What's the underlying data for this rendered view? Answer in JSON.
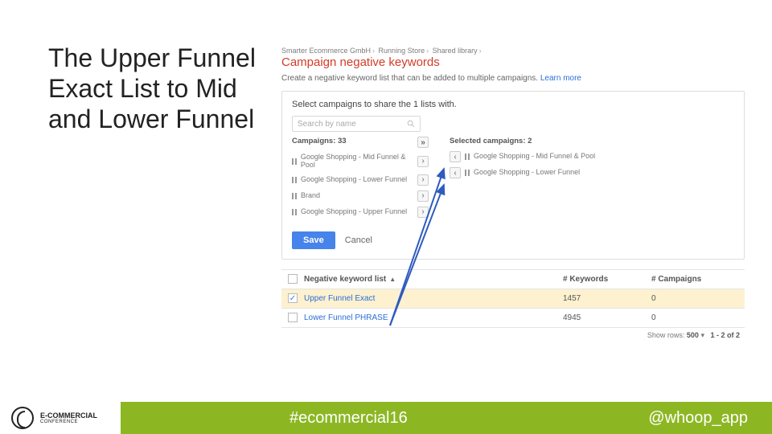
{
  "slide_title": "The Upper Funnel Exact List to Mid and Lower Funnel",
  "breadcrumbs": [
    "Smarter Ecommerce GmbH",
    "Running Store",
    "Shared library"
  ],
  "page_heading": "Campaign negative keywords",
  "description_a": "Create a negative keyword list that can be added to multiple campaigns.",
  "description_link": "Learn more",
  "dialog": {
    "title": "Select campaigns to share the 1 lists with.",
    "search_placeholder": "Search by name",
    "left_head": "Campaigns: 33",
    "right_head": "Selected campaigns: 2",
    "avail": [
      "Google Shopping - Mid Funnel & Pool",
      "Google Shopping - Lower Funnel",
      "Brand",
      "Google Shopping - Upper Funnel"
    ],
    "selected": [
      "Google Shopping - Mid Funnel & Pool",
      "Google Shopping - Lower Funnel"
    ],
    "save_label": "Save",
    "cancel_label": "Cancel"
  },
  "table": {
    "headers": [
      "Negative keyword list",
      "# Keywords",
      "# Campaigns"
    ],
    "rows": [
      {
        "checked": true,
        "name": "Upper Funnel Exact",
        "keywords": "1457",
        "campaigns": "0"
      },
      {
        "checked": false,
        "name": "Lower Funnel PHRASE",
        "keywords": "4945",
        "campaigns": "0"
      }
    ],
    "footer_label": "Show rows:",
    "footer_rows": "500",
    "footer_range": "1 - 2 of 2"
  },
  "footer": {
    "logo_l1": "E-COMMERCIAL",
    "logo_l2": "CONFERENCE",
    "hashtag": "#ecommercial16",
    "handle": "@whoop_app"
  }
}
